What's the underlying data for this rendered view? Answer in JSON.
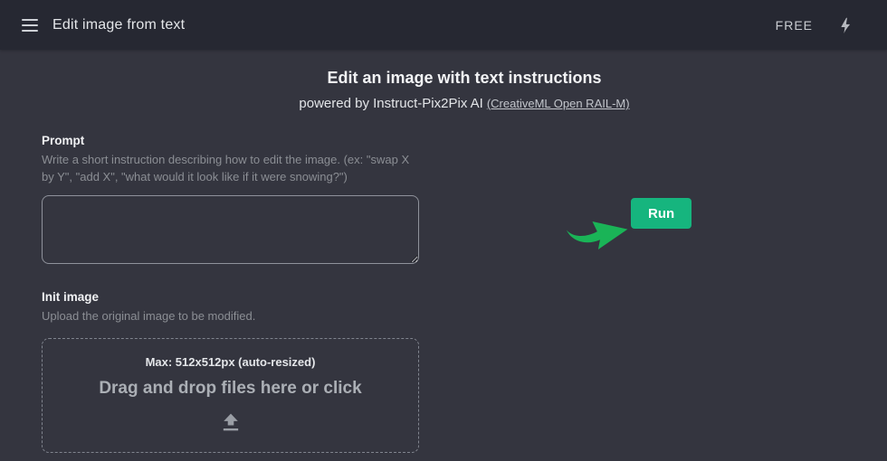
{
  "topbar": {
    "title": "Edit image from text",
    "plan_badge": "FREE"
  },
  "hero": {
    "title": "Edit an image with text instructions",
    "subtitle_prefix": "powered by Instruct-Pix2Pix AI",
    "subtitle_link": "(CreativeML Open RAIL-M)"
  },
  "prompt": {
    "label": "Prompt",
    "help": "Write a short instruction describing how to edit the image. (ex: \"swap X by Y\", \"add X\", \"what would it look like if it were snowing?\")",
    "value": "",
    "placeholder": ""
  },
  "run_button": {
    "label": "Run"
  },
  "init_image": {
    "label": "Init image",
    "help": "Upload the original image to be modified.",
    "dropzone": {
      "max_note": "Max: 512x512px (auto-resized)",
      "instruction": "Drag and drop files here or click"
    }
  },
  "icons": {
    "menu": "hamburger-three-bars",
    "bolt": "lightning-bolt",
    "run_arrow": "curved-green-arrow-pointing-to-run",
    "upload": "upload-arrow-with-baseline"
  },
  "colors": {
    "topbar_bg": "#262832",
    "page_bg": "#34353f",
    "run_button_green": "#16b57e",
    "arrow_green": "#1ab457",
    "text_primary": "#f0f1f3",
    "text_muted": "#8b8e94",
    "dropzone_border": "#80848e"
  }
}
